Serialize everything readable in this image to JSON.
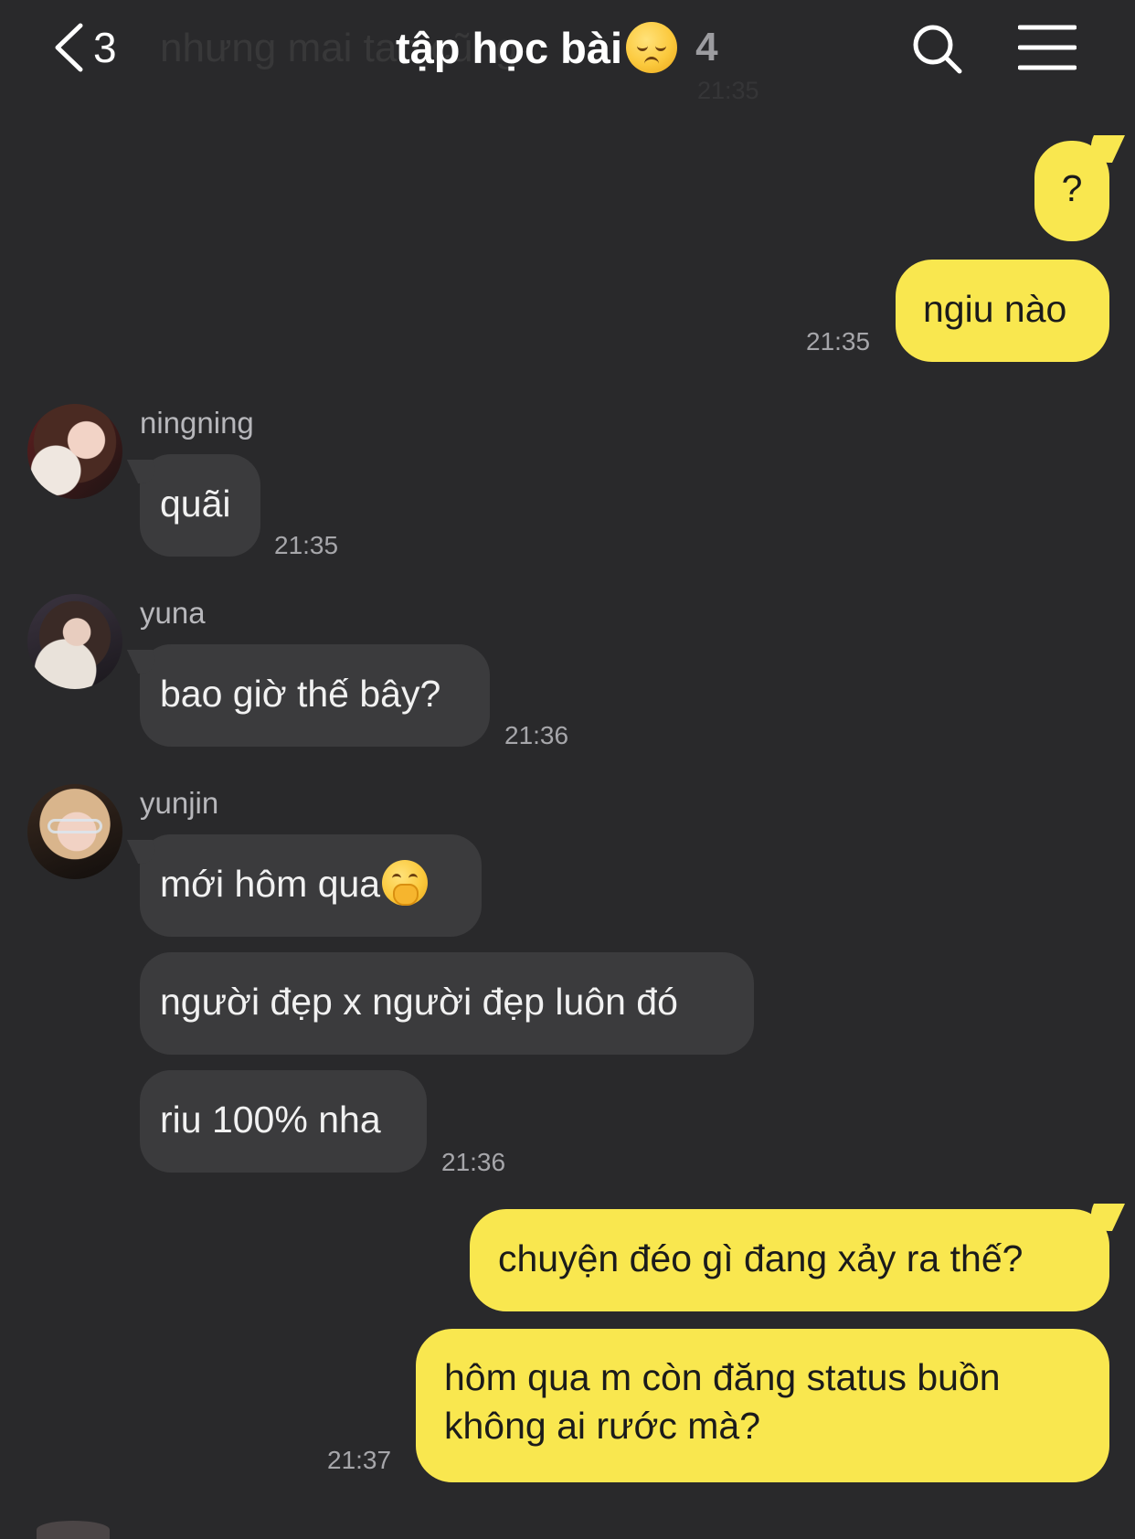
{
  "header": {
    "back_count": "3",
    "title": "tập học bài",
    "title_emoji": "pensive-face-emoji",
    "member_count": "4",
    "ghost_preview_text": "nhưng mai tao cũng",
    "ghost_preview_time": "21:35"
  },
  "colors": {
    "background": "#29292b",
    "my_bubble": "#f9e74f",
    "other_bubble": "#3b3b3d",
    "timestamp": "#a6a6aa"
  },
  "messages": [
    {
      "from": "me",
      "text": "?"
    },
    {
      "from": "me",
      "text": "ngiu nào",
      "time": "21:35"
    },
    {
      "from": "ningning",
      "sender": "ningning",
      "text": "quãi",
      "time": "21:35"
    },
    {
      "from": "yuna",
      "sender": "yuna",
      "text": "bao giờ thế bây?",
      "time": "21:36"
    },
    {
      "from": "yunjin",
      "sender": "yunjin",
      "text": "mới hôm qua",
      "emoji": "face-with-hand-over-mouth-emoji"
    },
    {
      "from": "yunjin",
      "text": "người đẹp x người đẹp luôn đó"
    },
    {
      "from": "yunjin",
      "text": "riu 100% nha",
      "time": "21:36"
    },
    {
      "from": "me",
      "text": "chuyện đéo gì đang xảy ra thế?"
    },
    {
      "from": "me",
      "lines": [
        "hôm qua m còn đăng status buồn",
        "không ai rước mà?"
      ],
      "time": "21:37"
    }
  ]
}
